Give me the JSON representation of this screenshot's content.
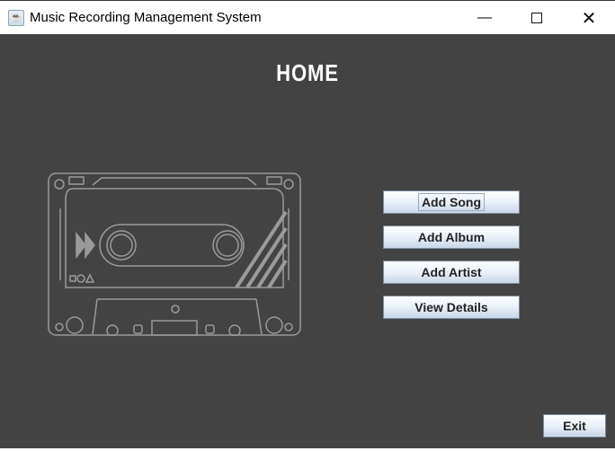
{
  "window": {
    "title": "Music Recording Management System",
    "controls": [
      "minimize",
      "maximize",
      "close"
    ]
  },
  "main": {
    "heading": "HOME",
    "buttons": [
      {
        "label": "Add Song"
      },
      {
        "label": "Add Album"
      },
      {
        "label": "Add Artist"
      },
      {
        "label": "View Details"
      }
    ],
    "exit_label": "Exit",
    "image": "cassette-tape-illustration"
  },
  "colors": {
    "background": "#434343",
    "line_art": "#9a9a9a"
  }
}
